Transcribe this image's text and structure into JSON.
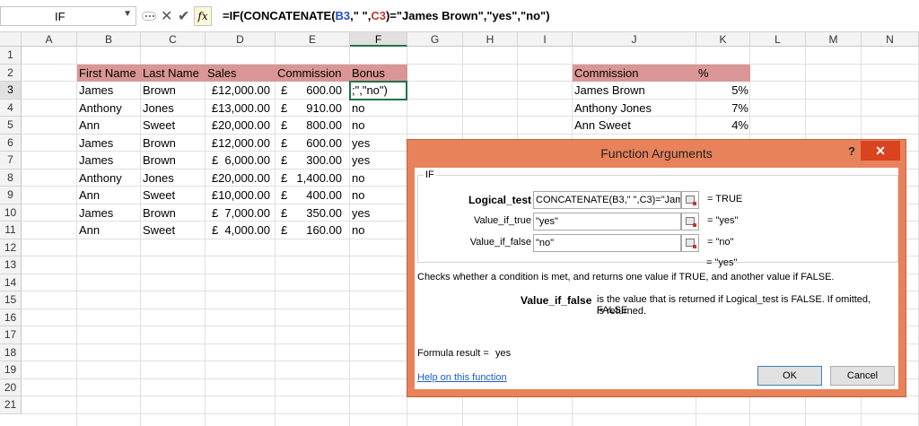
{
  "formula_bar": {
    "name_box": "IF",
    "formula_prefix": "=IF(CONCATENATE(",
    "formula_ref1": "B3",
    "formula_mid": ",\" \",",
    "formula_ref2": "C3",
    "formula_suffix": ")=\"James Brown\",\"yes\",\"no\")"
  },
  "columns": [
    "A",
    "B",
    "C",
    "D",
    "E",
    "F",
    "G",
    "H",
    "I",
    "J",
    "K",
    "L",
    "M",
    "N"
  ],
  "rows": [
    "1",
    "2",
    "3",
    "4",
    "5",
    "6",
    "7",
    "8",
    "9",
    "10",
    "11",
    "12",
    "13",
    "14",
    "15",
    "16",
    "17",
    "18",
    "19",
    "20",
    "21"
  ],
  "table": {
    "headers": [
      "First Name",
      "Last Name",
      "Sales",
      "Commission",
      "Bonus"
    ],
    "rows": [
      [
        "James",
        "Brown",
        "£12,000.00",
        "£",
        "600.00",
        ";\",\"no\")"
      ],
      [
        "Anthony",
        "Jones",
        "£13,000.00",
        "£",
        "910.00",
        "no"
      ],
      [
        "Ann",
        "Sweet",
        "£20,000.00",
        "£",
        "800.00",
        "no"
      ],
      [
        "James",
        "Brown",
        "£12,000.00",
        "£",
        "600.00",
        "yes"
      ],
      [
        "James",
        "Brown",
        "£  6,000.00",
        "£",
        "300.00",
        "yes"
      ],
      [
        "Anthony",
        "Jones",
        "£20,000.00",
        "£",
        "1,400.00",
        "no"
      ],
      [
        "Ann",
        "Sweet",
        "£10,000.00",
        "£",
        "400.00",
        "no"
      ],
      [
        "James",
        "Brown",
        "£  7,000.00",
        "£",
        "350.00",
        "yes"
      ],
      [
        "Ann",
        "Sweet",
        "£  4,000.00",
        "£",
        "160.00",
        "no"
      ]
    ]
  },
  "commission_table": {
    "headers": [
      "Commission",
      "%"
    ],
    "rows": [
      [
        "James Brown",
        "5%"
      ],
      [
        "Anthony Jones",
        "7%"
      ],
      [
        "Ann Sweet",
        "4%"
      ]
    ]
  },
  "dialog": {
    "title": "Function Arguments",
    "help": "?",
    "close": "✕",
    "function_name": "IF",
    "args": [
      {
        "label": "Logical_test",
        "value": "CONCATENATE(B3,\" \",C3)=\"Jame",
        "result": "=  TRUE"
      },
      {
        "label": "Value_if_true",
        "value": "\"yes\"",
        "result": "=  \"yes\""
      },
      {
        "label": "Value_if_false",
        "value": "\"no\"",
        "result": "=  \"no\""
      }
    ],
    "overall_result": "=  \"yes\"",
    "description": "Checks whether a condition is met, and returns one value if TRUE, and another value if FALSE.",
    "arg_help_name": "Value_if_false",
    "arg_help_text_1": "is the value that is returned if Logical_test is FALSE. If omitted, FALSE",
    "arg_help_text_2": "is returned.",
    "formula_result_label": "Formula result =",
    "formula_result_value": "yes",
    "help_link": "Help on this function",
    "ok": "OK",
    "cancel": "Cancel"
  },
  "colors": {
    "header_fill": "#d99694",
    "dialog_frame": "#e8825a",
    "close_button": "#d9441f",
    "ref_blue": "#1f4fd1",
    "ref_red": "#c0392b"
  }
}
